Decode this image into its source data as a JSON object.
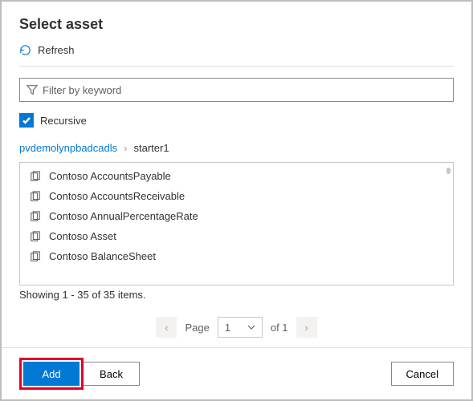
{
  "title": "Select asset",
  "refresh_label": "Refresh",
  "filter": {
    "placeholder": "Filter by keyword",
    "value": ""
  },
  "recursive": {
    "label": "Recursive",
    "checked": true
  },
  "breadcrumb": {
    "root": "pvdemolynpbadcadls",
    "current": "starter1"
  },
  "assets": [
    {
      "name": "Contoso AccountsPayable"
    },
    {
      "name": "Contoso AccountsReceivable"
    },
    {
      "name": "Contoso AnnualPercentageRate"
    },
    {
      "name": "Contoso Asset"
    },
    {
      "name": "Contoso BalanceSheet"
    }
  ],
  "status": "Showing 1 - 35 of 35 items.",
  "pager": {
    "page_label": "Page",
    "of_label": "of 1",
    "current": "1"
  },
  "buttons": {
    "add": "Add",
    "back": "Back",
    "cancel": "Cancel"
  },
  "colors": {
    "accent": "#0078d4",
    "highlight": "#e3002b"
  }
}
